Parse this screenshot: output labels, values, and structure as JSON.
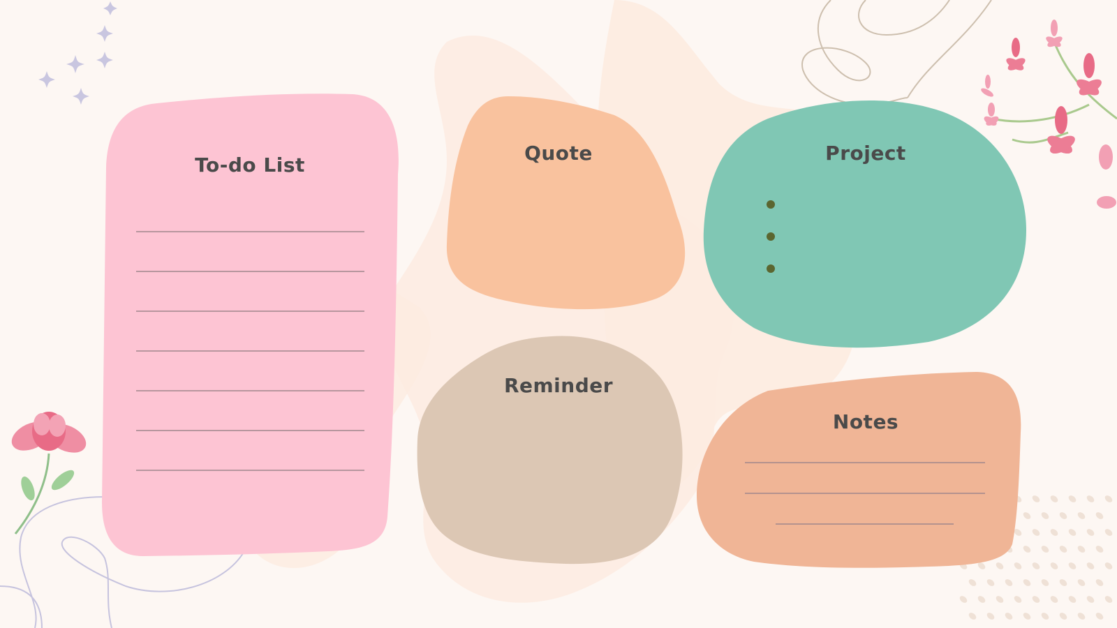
{
  "cards": {
    "todo": {
      "title": "To-do List",
      "color": "#fdc4d3",
      "lines": 7
    },
    "quote": {
      "title": "Quote",
      "color": "#f9c29e"
    },
    "project": {
      "title": "Project",
      "color": "#80c7b4",
      "bullets": 3
    },
    "reminder": {
      "title": "Reminder",
      "color": "#dcc7b4"
    },
    "notes": {
      "title": "Notes",
      "color": "#f0b596",
      "lines": 3
    }
  },
  "colors": {
    "background": "#fdf7f3",
    "blob": "#fdebe0",
    "line": "#a0868c",
    "bullet": "#5b6630",
    "sparkle": "#c9c6e0",
    "dots": "#efe1d6",
    "flower": "#e86b86"
  },
  "decorations": {
    "top_left": "sparkle-cluster-icon",
    "bottom_left": "pink-flower-icon",
    "top_right": "cherry-blossom-branch-icon",
    "bottom_right": "dot-pattern-icon"
  }
}
